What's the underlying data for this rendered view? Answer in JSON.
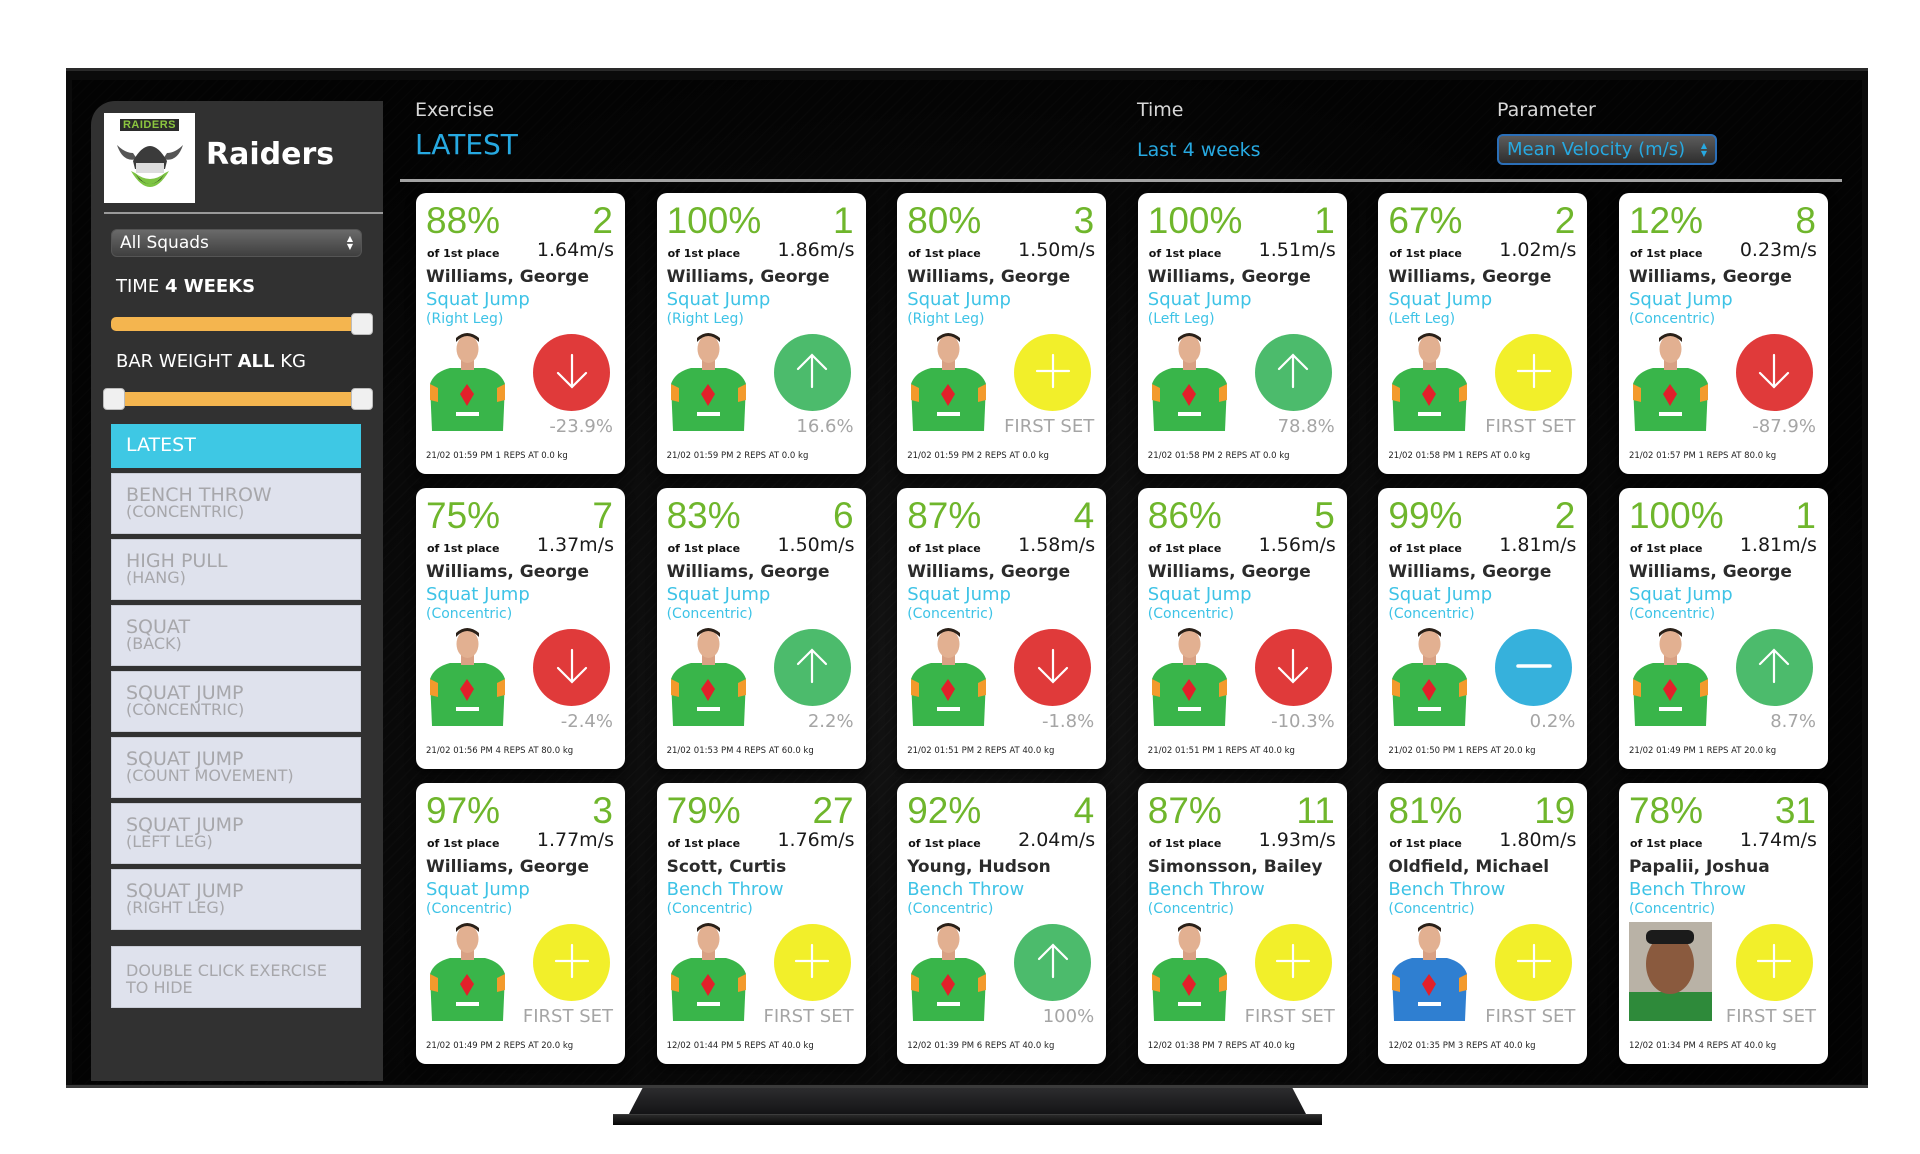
{
  "sidebar": {
    "team_name": "Raiders",
    "logo_text": "RAIDERS",
    "squad_select": "All Squads",
    "time_label": "TIME",
    "time_value": "4 WEEKS",
    "time_slider": {
      "value_fraction": 1.0
    },
    "weight_label_prefix": "BAR WEIGHT",
    "weight_value": "ALL",
    "weight_label_suffix": "KG",
    "weight_slider": {
      "low_fraction": 0.0,
      "high_fraction": 1.0
    },
    "exercises": [
      {
        "name": "LATEST",
        "sub": "",
        "active": true
      },
      {
        "name": "BENCH THROW",
        "sub": "(CONCENTRIC)",
        "active": false
      },
      {
        "name": "HIGH PULL",
        "sub": "(HANG)",
        "active": false
      },
      {
        "name": "SQUAT",
        "sub": "(BACK)",
        "active": false
      },
      {
        "name": "SQUAT JUMP",
        "sub": "(CONCENTRIC)",
        "active": false
      },
      {
        "name": "SQUAT JUMP",
        "sub": "(COUNT MOVEMENT)",
        "active": false
      },
      {
        "name": "SQUAT JUMP",
        "sub": "(LEFT LEG)",
        "active": false
      },
      {
        "name": "SQUAT JUMP",
        "sub": "(RIGHT LEG)",
        "active": false
      }
    ],
    "hint": "DOUBLE CLICK EXERCISE TO HIDE"
  },
  "header": {
    "exercise_label": "Exercise",
    "exercise_value": "LATEST",
    "time_label": "Time",
    "time_value": "Last 4 weeks",
    "parameter_label": "Parameter",
    "parameter_value": "Mean Velocity (m/s)"
  },
  "colors": {
    "down": "#e03a3a",
    "up": "#4cbb6c",
    "first": "#f2ef2a",
    "same": "#36b1dc",
    "accent": "#3ec8e4",
    "pct_green": "#6fb62c"
  },
  "of_first_label": "of 1st place",
  "cards": [
    {
      "pct": "88%",
      "rank": "2",
      "vel": "1.64m/s",
      "name": "Williams, George",
      "exercise": "Squat Jump",
      "variant": "(Right Leg)",
      "trend": "down",
      "change": "-23.9%",
      "footer": "21/02 01:59 PM 1 REPS AT 0.0 kg",
      "photo": "green"
    },
    {
      "pct": "100%",
      "rank": "1",
      "vel": "1.86m/s",
      "name": "Williams, George",
      "exercise": "Squat Jump",
      "variant": "(Right Leg)",
      "trend": "up",
      "change": "16.6%",
      "footer": "21/02 01:59 PM 2 REPS AT 0.0 kg",
      "photo": "green"
    },
    {
      "pct": "80%",
      "rank": "3",
      "vel": "1.50m/s",
      "name": "Williams, George",
      "exercise": "Squat Jump",
      "variant": "(Right Leg)",
      "trend": "first",
      "change": "FIRST SET",
      "footer": "21/02 01:59 PM 2 REPS AT 0.0 kg",
      "photo": "green"
    },
    {
      "pct": "100%",
      "rank": "1",
      "vel": "1.51m/s",
      "name": "Williams, George",
      "exercise": "Squat Jump",
      "variant": "(Left Leg)",
      "trend": "up",
      "change": "78.8%",
      "footer": "21/02 01:58 PM 2 REPS AT 0.0 kg",
      "photo": "green"
    },
    {
      "pct": "67%",
      "rank": "2",
      "vel": "1.02m/s",
      "name": "Williams, George",
      "exercise": "Squat Jump",
      "variant": "(Left Leg)",
      "trend": "first",
      "change": "FIRST SET",
      "footer": "21/02 01:58 PM 1 REPS AT 0.0 kg",
      "photo": "green"
    },
    {
      "pct": "12%",
      "rank": "8",
      "vel": "0.23m/s",
      "name": "Williams, George",
      "exercise": "Squat Jump",
      "variant": "(Concentric)",
      "trend": "down",
      "change": "-87.9%",
      "footer": "21/02 01:57 PM 1 REPS AT 80.0 kg",
      "photo": "green"
    },
    {
      "pct": "75%",
      "rank": "7",
      "vel": "1.37m/s",
      "name": "Williams, George",
      "exercise": "Squat Jump",
      "variant": "(Concentric)",
      "trend": "down",
      "change": "-2.4%",
      "footer": "21/02 01:56 PM 4 REPS AT 80.0 kg",
      "photo": "green"
    },
    {
      "pct": "83%",
      "rank": "6",
      "vel": "1.50m/s",
      "name": "Williams, George",
      "exercise": "Squat Jump",
      "variant": "(Concentric)",
      "trend": "up",
      "change": "2.2%",
      "footer": "21/02 01:53 PM 4 REPS AT 60.0 kg",
      "photo": "green"
    },
    {
      "pct": "87%",
      "rank": "4",
      "vel": "1.58m/s",
      "name": "Williams, George",
      "exercise": "Squat Jump",
      "variant": "(Concentric)",
      "trend": "down",
      "change": "-1.8%",
      "footer": "21/02 01:51 PM 2 REPS AT 40.0 kg",
      "photo": "green"
    },
    {
      "pct": "86%",
      "rank": "5",
      "vel": "1.56m/s",
      "name": "Williams, George",
      "exercise": "Squat Jump",
      "variant": "(Concentric)",
      "trend": "down",
      "change": "-10.3%",
      "footer": "21/02 01:51 PM 1 REPS AT 40.0 kg",
      "photo": "green"
    },
    {
      "pct": "99%",
      "rank": "2",
      "vel": "1.81m/s",
      "name": "Williams, George",
      "exercise": "Squat Jump",
      "variant": "(Concentric)",
      "trend": "same",
      "change": "0.2%",
      "footer": "21/02 01:50 PM 1 REPS AT 20.0 kg",
      "photo": "green"
    },
    {
      "pct": "100%",
      "rank": "1",
      "vel": "1.81m/s",
      "name": "Williams, George",
      "exercise": "Squat Jump",
      "variant": "(Concentric)",
      "trend": "up",
      "change": "8.7%",
      "footer": "21/02 01:49 PM 1 REPS AT 20.0 kg",
      "photo": "green"
    },
    {
      "pct": "97%",
      "rank": "3",
      "vel": "1.77m/s",
      "name": "Williams, George",
      "exercise": "Squat Jump",
      "variant": "(Concentric)",
      "trend": "first",
      "change": "FIRST SET",
      "footer": "21/02 01:49 PM 2 REPS AT 20.0 kg",
      "photo": "green"
    },
    {
      "pct": "79%",
      "rank": "27",
      "vel": "1.76m/s",
      "name": "Scott, Curtis",
      "exercise": "Bench Throw",
      "variant": "(Concentric)",
      "trend": "first",
      "change": "FIRST SET",
      "footer": "12/02 01:44 PM 5 REPS AT 40.0 kg",
      "photo": "green"
    },
    {
      "pct": "92%",
      "rank": "4",
      "vel": "2.04m/s",
      "name": "Young, Hudson",
      "exercise": "Bench Throw",
      "variant": "(Concentric)",
      "trend": "up",
      "change": "100%",
      "footer": "12/02 01:39 PM 6 REPS AT 40.0 kg",
      "photo": "green"
    },
    {
      "pct": "87%",
      "rank": "11",
      "vel": "1.93m/s",
      "name": "Simonsson, Bailey",
      "exercise": "Bench Throw",
      "variant": "(Concentric)",
      "trend": "first",
      "change": "FIRST SET",
      "footer": "12/02 01:38 PM 7 REPS AT 40.0 kg",
      "photo": "green"
    },
    {
      "pct": "81%",
      "rank": "19",
      "vel": "1.80m/s",
      "name": "Oldfield, Michael",
      "exercise": "Bench Throw",
      "variant": "(Concentric)",
      "trend": "first",
      "change": "FIRST SET",
      "footer": "12/02 01:35 PM 3 REPS AT 40.0 kg",
      "photo": "blue"
    },
    {
      "pct": "78%",
      "rank": "31",
      "vel": "1.74m/s",
      "name": "Papalii, Joshua",
      "exercise": "Bench Throw",
      "variant": "(Concentric)",
      "trend": "first",
      "change": "FIRST SET",
      "footer": "12/02 01:34 PM 4 REPS AT 40.0 kg",
      "photo": "headshot"
    }
  ]
}
